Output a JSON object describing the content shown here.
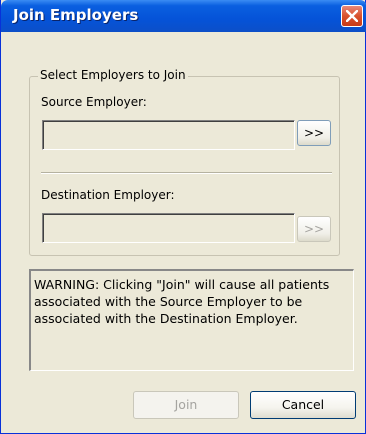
{
  "window": {
    "title": "Join Employers"
  },
  "group": {
    "legend": "Select Employers to Join",
    "source_label": "Source Employer:",
    "source_value": "",
    "source_browse_label": ">>",
    "destination_label": "Destination Employer:",
    "destination_value": "",
    "destination_browse_label": ">>"
  },
  "warning": {
    "text": "WARNING: Clicking \"Join\" will cause all patients associated with the Source Employer to be associated with the Destination Employer."
  },
  "buttons": {
    "join": "Join",
    "cancel": "Cancel"
  },
  "colors": {
    "titlebar": "#0553d8",
    "dialog_bg": "#ece9d8",
    "close_button": "#d9512d"
  },
  "icons": {
    "close": "close-icon"
  }
}
